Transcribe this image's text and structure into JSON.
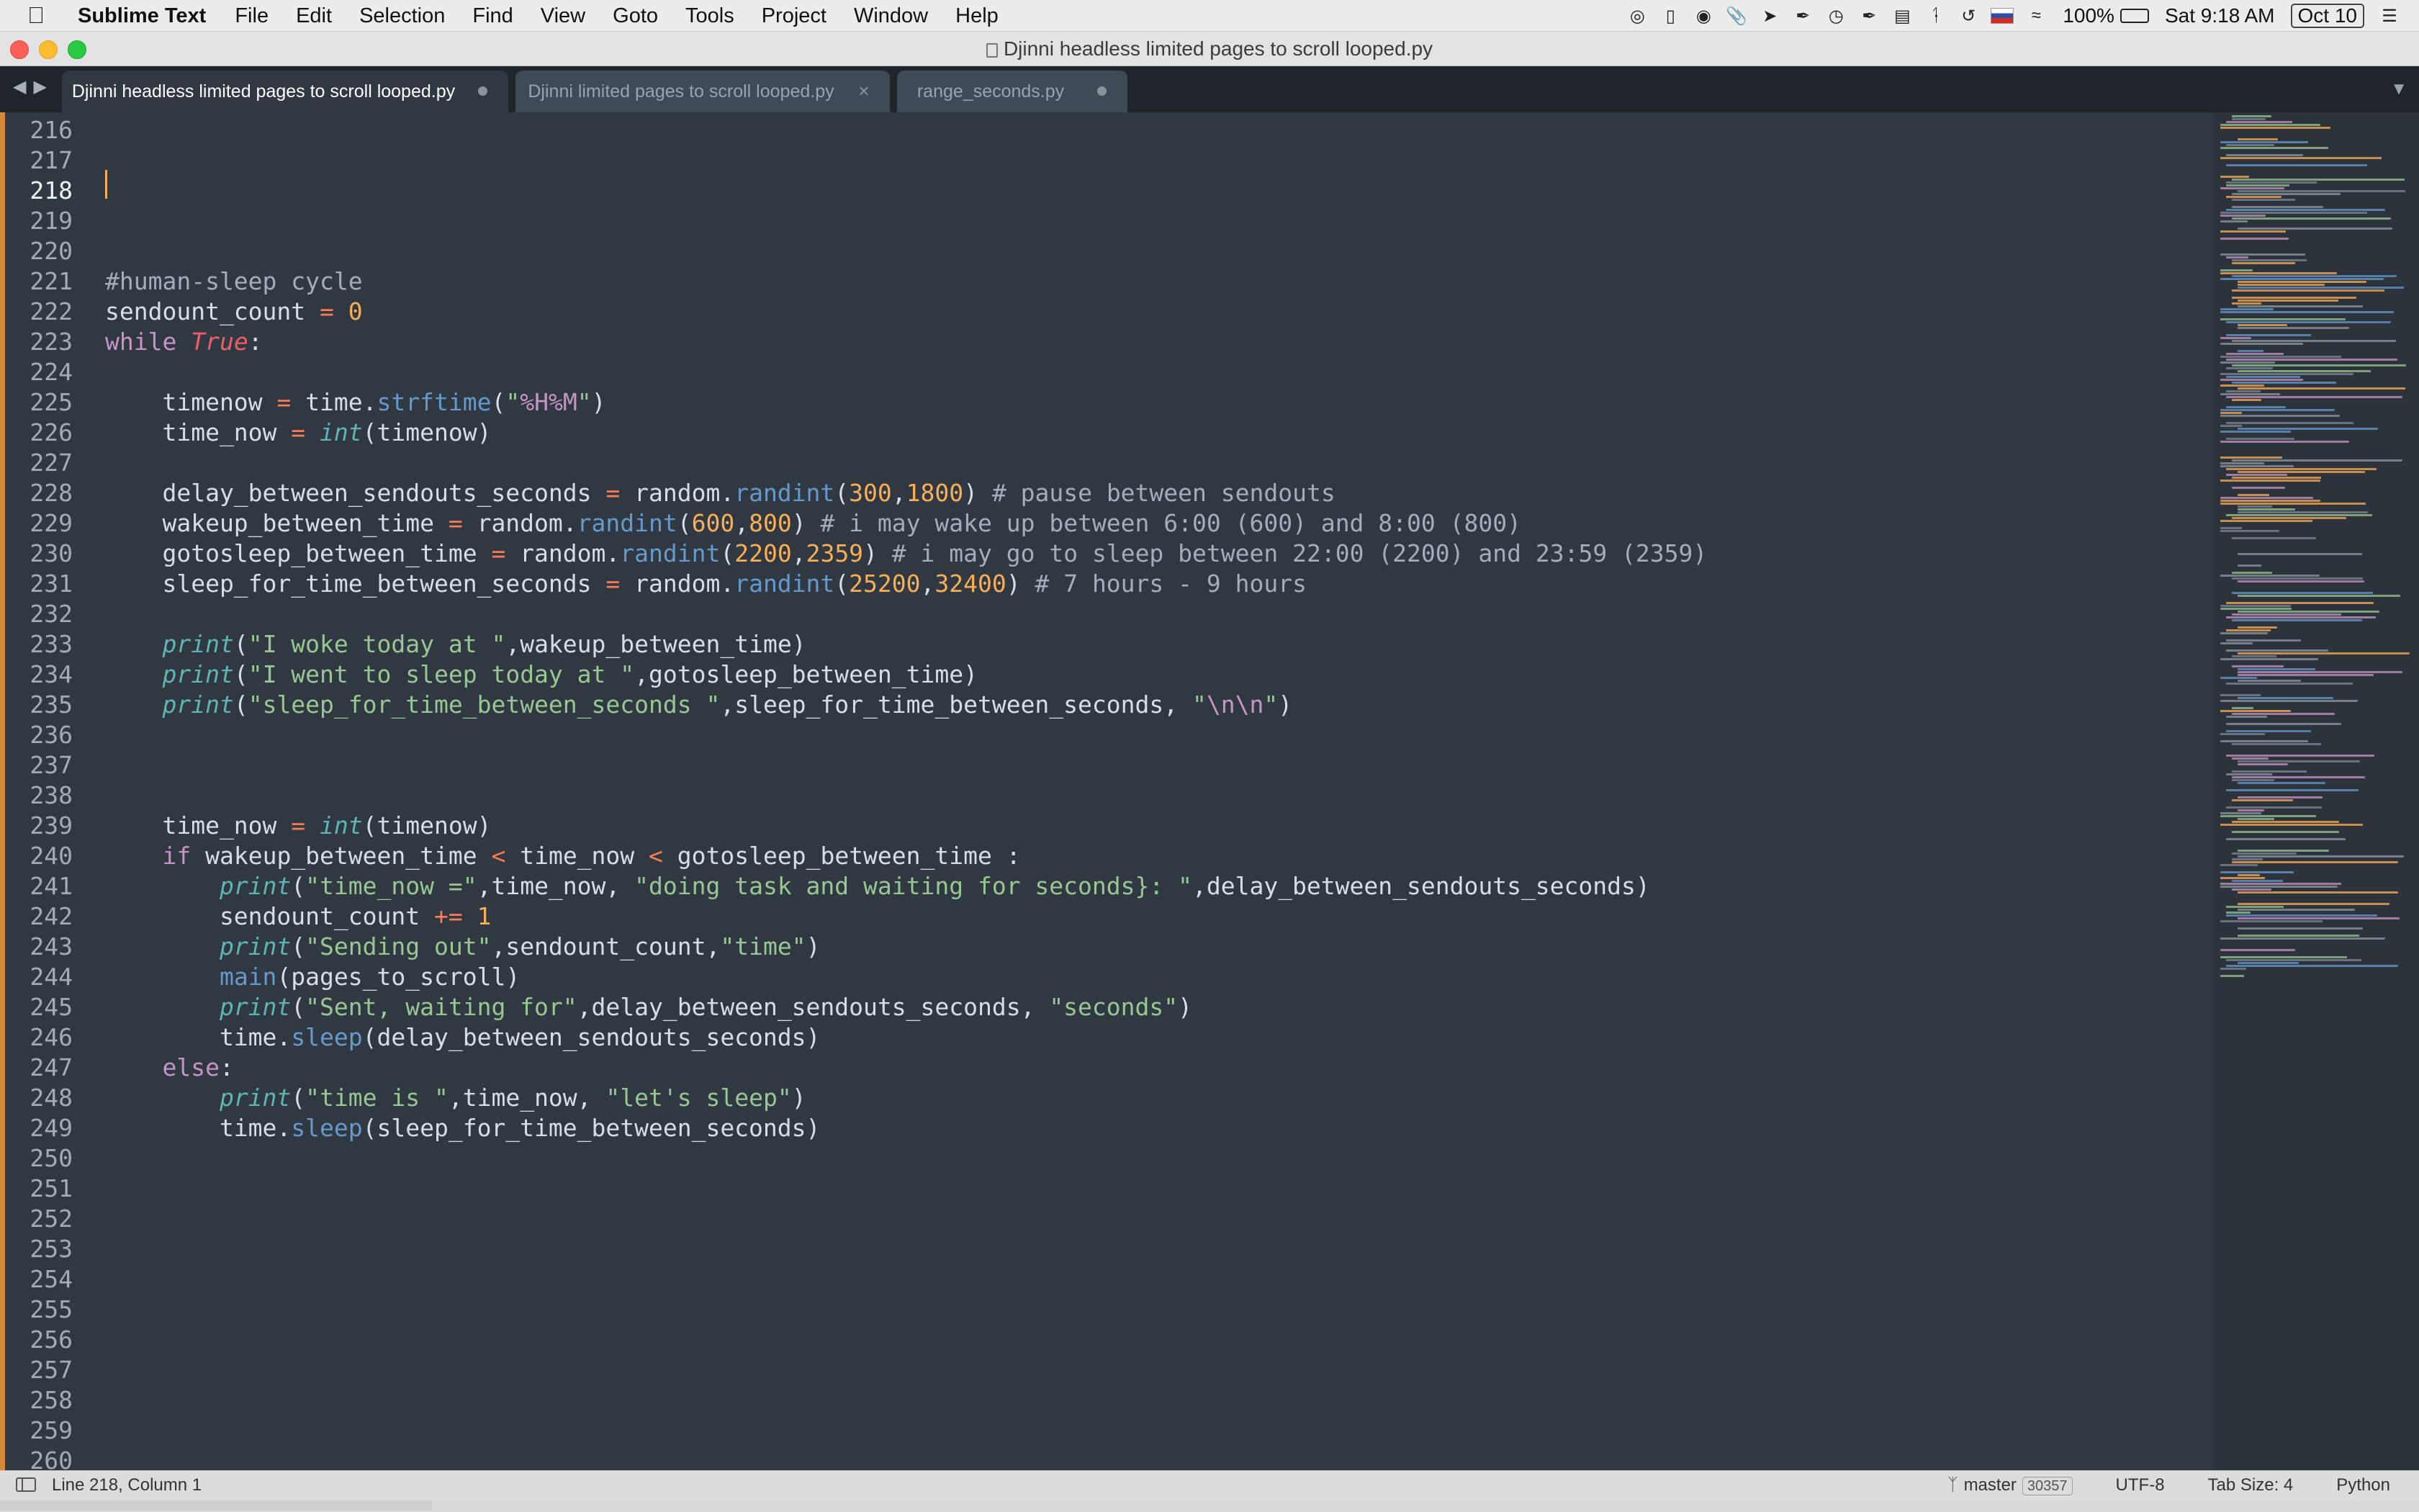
{
  "menubar": {
    "app_name": "Sublime Text",
    "items": [
      "File",
      "Edit",
      "Selection",
      "Find",
      "View",
      "Goto",
      "Tools",
      "Project",
      "Window",
      "Help"
    ],
    "status_icons": [
      "screen-mirror-icon",
      "phone-icon",
      "cloud-icon",
      "paperclip-icon",
      "compass-icon",
      "pen-icon",
      "clock-icon",
      "pen-alt-icon",
      "notes-icon",
      "bluetooth-icon",
      "time-machine-icon",
      "flag-icon",
      "wifi-icon"
    ],
    "battery_percent": "100%",
    "time": "Sat 9:18 AM",
    "date": "Oct 10"
  },
  "window": {
    "title": "Djinni headless limited pages to scroll looped.py"
  },
  "tabs": [
    {
      "label": "Djinni headless limited pages to scroll looped.py",
      "state": "modified",
      "active": true
    },
    {
      "label": "Djinni limited pages to scroll looped.py",
      "state": "close",
      "active": false
    },
    {
      "label": "range_seconds.py",
      "state": "modified",
      "active": false
    }
  ],
  "editor": {
    "first_line": 216,
    "current_line": 218,
    "lines": [
      "216",
      "217",
      "218",
      "219",
      "220",
      "221",
      "222",
      "223",
      "224",
      "225",
      "226",
      "227",
      "228",
      "229",
      "230",
      "231",
      "232",
      "233",
      "234",
      "235",
      "236",
      "237",
      "238",
      "239",
      "240",
      "241",
      "242",
      "243",
      "244",
      "245",
      "246",
      "247",
      "248",
      "249",
      "250",
      "251",
      "252",
      "253",
      "254",
      "255",
      "256",
      "257",
      "258",
      "259",
      "260"
    ],
    "code": [
      [],
      [],
      [],
      [],
      [],
      [
        [
          "c",
          "#human-sleep cycle"
        ]
      ],
      [
        [
          "p",
          "sendount_count "
        ],
        [
          "o",
          "="
        ],
        [
          "p",
          " "
        ],
        [
          "n",
          "0"
        ]
      ],
      [
        [
          "kw",
          "while"
        ],
        [
          "p",
          " "
        ],
        [
          "bi",
          "True"
        ],
        [
          "p",
          ":"
        ]
      ],
      [],
      [
        [
          "p",
          "    timenow "
        ],
        [
          "o",
          "="
        ],
        [
          "p",
          " time."
        ],
        [
          "f",
          "strftime"
        ],
        [
          "p",
          "("
        ],
        [
          "s",
          "\""
        ],
        [
          "e",
          "%H%M"
        ],
        [
          "s",
          "\""
        ],
        [
          "p",
          ")"
        ]
      ],
      [
        [
          "p",
          "    time_now "
        ],
        [
          "o",
          "="
        ],
        [
          "p",
          " "
        ],
        [
          "b",
          "int"
        ],
        [
          "p",
          "(timenow)"
        ]
      ],
      [],
      [
        [
          "p",
          "    delay_between_sendouts_seconds "
        ],
        [
          "o",
          "="
        ],
        [
          "p",
          " random."
        ],
        [
          "f",
          "randint"
        ],
        [
          "p",
          "("
        ],
        [
          "n",
          "300"
        ],
        [
          "p",
          ","
        ],
        [
          "n",
          "1800"
        ],
        [
          "p",
          ") "
        ],
        [
          "c",
          "# pause between sendouts"
        ]
      ],
      [
        [
          "p",
          "    wakeup_between_time "
        ],
        [
          "o",
          "="
        ],
        [
          "p",
          " random."
        ],
        [
          "f",
          "randint"
        ],
        [
          "p",
          "("
        ],
        [
          "n",
          "600"
        ],
        [
          "p",
          ","
        ],
        [
          "n",
          "800"
        ],
        [
          "p",
          ") "
        ],
        [
          "c",
          "# i may wake up between 6:00 (600) and 8:00 (800)"
        ]
      ],
      [
        [
          "p",
          "    gotosleep_between_time "
        ],
        [
          "o",
          "="
        ],
        [
          "p",
          " random."
        ],
        [
          "f",
          "randint"
        ],
        [
          "p",
          "("
        ],
        [
          "n",
          "2200"
        ],
        [
          "p",
          ","
        ],
        [
          "n",
          "2359"
        ],
        [
          "p",
          ") "
        ],
        [
          "c",
          "# i may go to sleep between 22:00 (2200) and 23:59 (2359)"
        ]
      ],
      [
        [
          "p",
          "    sleep_for_time_between_seconds "
        ],
        [
          "o",
          "="
        ],
        [
          "p",
          " random."
        ],
        [
          "f",
          "randint"
        ],
        [
          "p",
          "("
        ],
        [
          "n",
          "25200"
        ],
        [
          "p",
          ","
        ],
        [
          "n",
          "32400"
        ],
        [
          "p",
          ") "
        ],
        [
          "c",
          "# 7 hours - 9 hours"
        ]
      ],
      [],
      [
        [
          "p",
          "    "
        ],
        [
          "b",
          "print"
        ],
        [
          "p",
          "("
        ],
        [
          "s",
          "\"I woke today at \""
        ],
        [
          "p",
          ",wakeup_between_time)"
        ]
      ],
      [
        [
          "p",
          "    "
        ],
        [
          "b",
          "print"
        ],
        [
          "p",
          "("
        ],
        [
          "s",
          "\"I went to sleep today at \""
        ],
        [
          "p",
          ",gotosleep_between_time)"
        ]
      ],
      [
        [
          "p",
          "    "
        ],
        [
          "b",
          "print"
        ],
        [
          "p",
          "("
        ],
        [
          "s",
          "\"sleep_for_time_between_seconds \""
        ],
        [
          "p",
          ",sleep_for_time_between_seconds, "
        ],
        [
          "s",
          "\""
        ],
        [
          "e",
          "\\n\\n"
        ],
        [
          "s",
          "\""
        ],
        [
          "p",
          ")"
        ]
      ],
      [],
      [],
      [],
      [
        [
          "p",
          "    time_now "
        ],
        [
          "o",
          "="
        ],
        [
          "p",
          " "
        ],
        [
          "b",
          "int"
        ],
        [
          "p",
          "(timenow)"
        ]
      ],
      [
        [
          "p",
          "    "
        ],
        [
          "kw",
          "if"
        ],
        [
          "p",
          " wakeup_between_time "
        ],
        [
          "o",
          "<"
        ],
        [
          "p",
          " time_now "
        ],
        [
          "o",
          "<"
        ],
        [
          "p",
          " gotosleep_between_time :"
        ]
      ],
      [
        [
          "p",
          "        "
        ],
        [
          "b",
          "print"
        ],
        [
          "p",
          "("
        ],
        [
          "s",
          "\"time_now =\""
        ],
        [
          "p",
          ",time_now, "
        ],
        [
          "s",
          "\"doing task and waiting for seconds}: \""
        ],
        [
          "p",
          ",delay_between_sendouts_seconds)"
        ]
      ],
      [
        [
          "p",
          "        sendount_count "
        ],
        [
          "o",
          "+="
        ],
        [
          "p",
          " "
        ],
        [
          "n",
          "1"
        ]
      ],
      [
        [
          "p",
          "        "
        ],
        [
          "b",
          "print"
        ],
        [
          "p",
          "("
        ],
        [
          "s",
          "\"Sending out\""
        ],
        [
          "p",
          ",sendount_count,"
        ],
        [
          "s",
          "\"time\""
        ],
        [
          "p",
          ")"
        ]
      ],
      [
        [
          "p",
          "        "
        ],
        [
          "f",
          "main"
        ],
        [
          "p",
          "(pages_to_scroll)"
        ]
      ],
      [
        [
          "p",
          "        "
        ],
        [
          "b",
          "print"
        ],
        [
          "p",
          "("
        ],
        [
          "s",
          "\"Sent, waiting for\""
        ],
        [
          "p",
          ",delay_between_sendouts_seconds, "
        ],
        [
          "s",
          "\"seconds\""
        ],
        [
          "p",
          ")"
        ]
      ],
      [
        [
          "p",
          "        time."
        ],
        [
          "f",
          "sleep"
        ],
        [
          "p",
          "(delay_between_sendouts_seconds)"
        ]
      ],
      [
        [
          "p",
          "    "
        ],
        [
          "kw",
          "else"
        ],
        [
          "p",
          ":"
        ]
      ],
      [
        [
          "p",
          "        "
        ],
        [
          "b",
          "print"
        ],
        [
          "p",
          "("
        ],
        [
          "s",
          "\"time is \""
        ],
        [
          "p",
          ",time_now, "
        ],
        [
          "s",
          "\"let's sleep\""
        ],
        [
          "p",
          ")"
        ]
      ],
      [
        [
          "p",
          "        time."
        ],
        [
          "f",
          "sleep"
        ],
        [
          "p",
          "(sleep_for_time_between_seconds)"
        ]
      ],
      [],
      [],
      [],
      [],
      [],
      [],
      [],
      [],
      [],
      [],
      []
    ]
  },
  "statusbar": {
    "position": "Line 218, Column 1",
    "branch": "master",
    "branch_count": "30357",
    "encoding": "UTF-8",
    "tab_size": "Tab Size: 4",
    "syntax": "Python"
  },
  "colors": {
    "editor_bg": "#303841",
    "tab_bar_bg": "#1f252b",
    "caret": "#f9ae58",
    "edge_bar": "#d68a37"
  }
}
